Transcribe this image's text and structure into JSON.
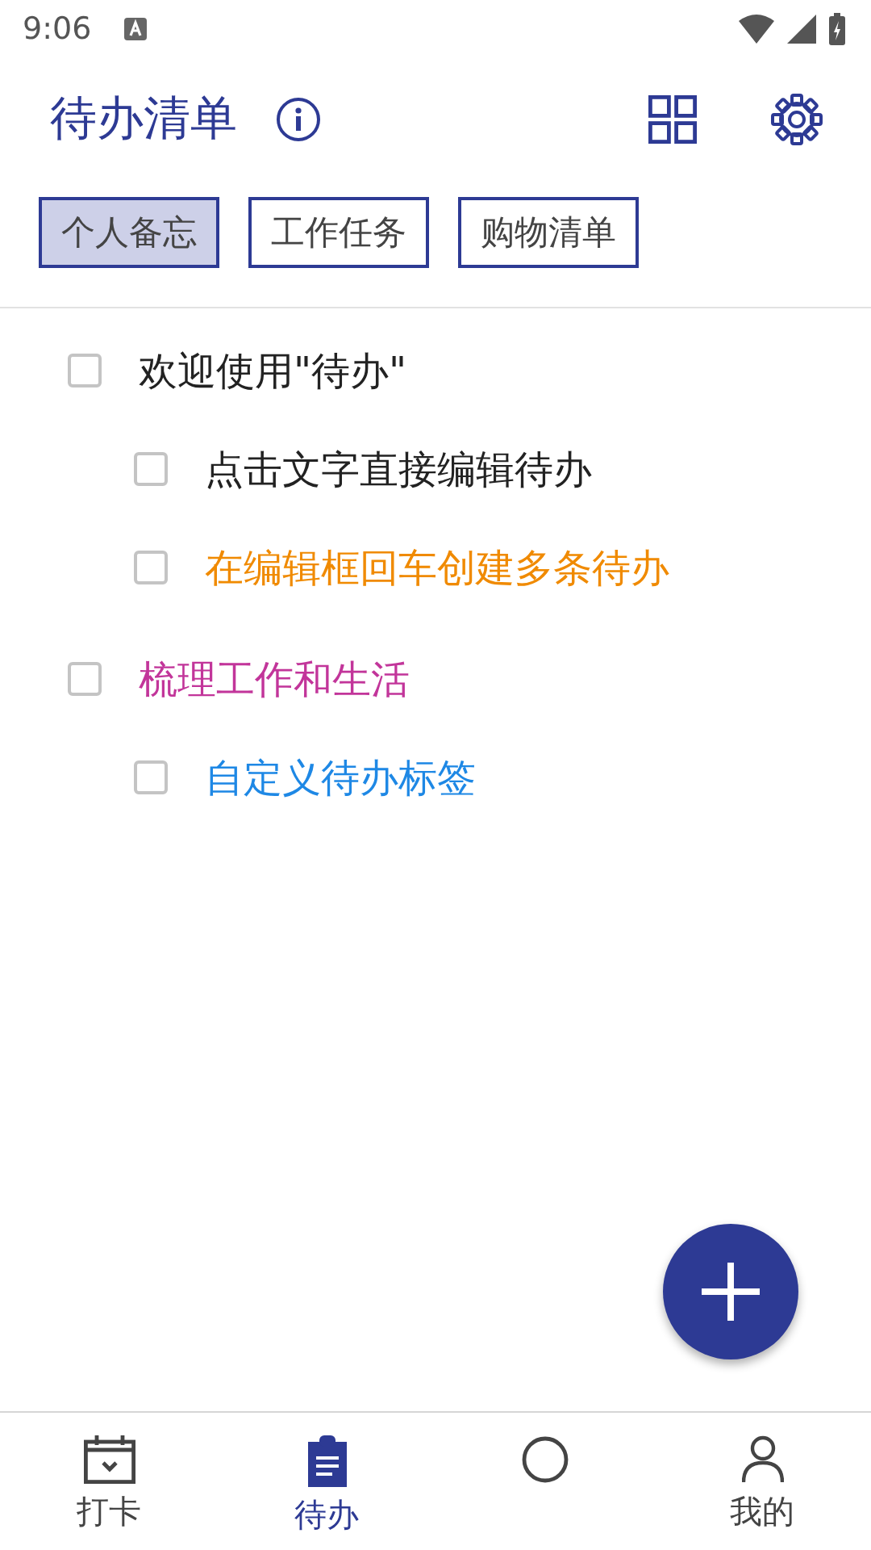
{
  "status_bar": {
    "time": "9:06"
  },
  "header": {
    "title": "待办清单"
  },
  "tags": [
    {
      "label": "个人备忘",
      "selected": true
    },
    {
      "label": "工作任务",
      "selected": false
    },
    {
      "label": "购物清单",
      "selected": false
    }
  ],
  "todos": [
    {
      "text": "欢迎使用\"待办\"",
      "checked": false,
      "color": "#222222",
      "children": [
        {
          "text": "点击文字直接编辑待办",
          "checked": false,
          "color": "#222222"
        },
        {
          "text": "在编辑框回车创建多条待办",
          "checked": false,
          "color": "#f08a00"
        }
      ]
    },
    {
      "text": "梳理工作和生活",
      "checked": false,
      "color": "#c2359a",
      "children": [
        {
          "text": "自定义待办标签",
          "checked": false,
          "color": "#1e88e5"
        }
      ]
    }
  ],
  "nav": [
    {
      "kind": "calendar",
      "label": "打卡",
      "selected": false
    },
    {
      "kind": "clipboard",
      "label": "待办",
      "selected": true
    },
    {
      "kind": "circle",
      "selected": false
    },
    {
      "kind": "person",
      "label": "我的",
      "selected": false
    }
  ]
}
